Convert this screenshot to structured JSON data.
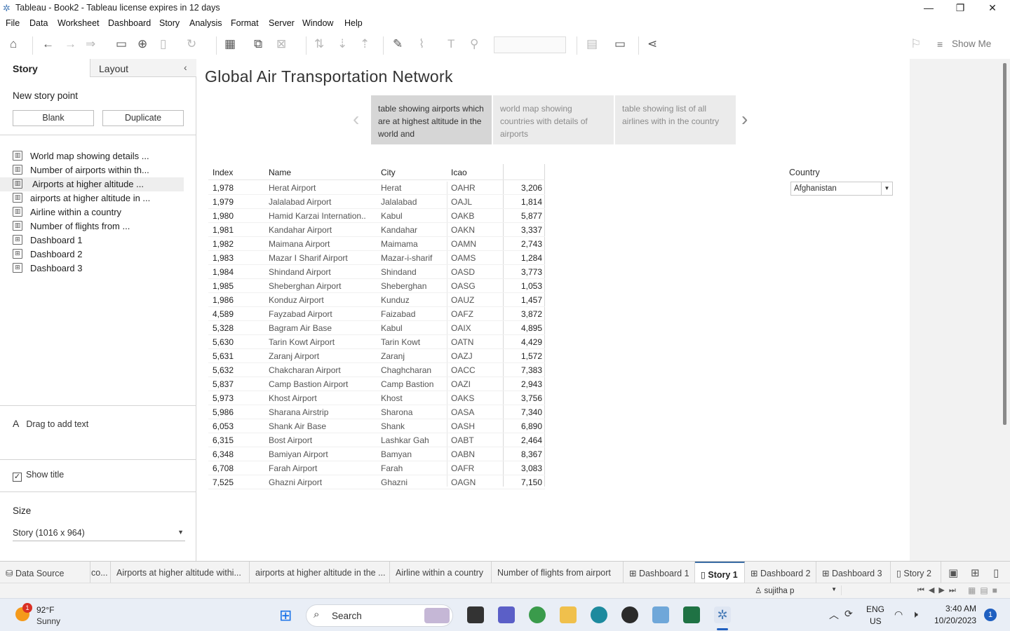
{
  "window": {
    "title": "Tableau - Book2 - Tableau license expires in 12 days"
  },
  "menu": [
    "File",
    "Data",
    "Worksheet",
    "Dashboard",
    "Story",
    "Analysis",
    "Format",
    "Server",
    "Window",
    "Help"
  ],
  "toolbar": {
    "show_me_label": "Show Me"
  },
  "left_panel": {
    "tabs": {
      "story": "Story",
      "layout": "Layout"
    },
    "new_story_point_label": "New story point",
    "blank_button": "Blank",
    "duplicate_button": "Duplicate",
    "sheets": [
      {
        "label": "World map showing  details ...",
        "type": "worksheet"
      },
      {
        "label": "Number of airports within th...",
        "type": "worksheet"
      },
      {
        "label": "Airports at higher altitude ...",
        "type": "worksheet",
        "selected": true
      },
      {
        "label": "airports at higher altitude in ...",
        "type": "worksheet"
      },
      {
        "label": "Airline within a country",
        "type": "worksheet"
      },
      {
        "label": "Number of flights from ...",
        "type": "worksheet"
      },
      {
        "label": "Dashboard 1",
        "type": "dashboard"
      },
      {
        "label": "Dashboard 2",
        "type": "dashboard"
      },
      {
        "label": "Dashboard 3",
        "type": "dashboard"
      }
    ],
    "drag_text_label": "Drag to add text",
    "show_title_label": "Show title",
    "size_label": "Size",
    "size_value": "Story (1016 x 964)"
  },
  "story": {
    "title": "Global Air  Transportation Network",
    "points": [
      {
        "caption": "table showing airports which are at highest altitude in the world and",
        "active": true
      },
      {
        "caption": "world map showing countries with details of airports",
        "active": false
      },
      {
        "caption": "table showing list of all airlines with in the country",
        "active": false
      }
    ]
  },
  "table": {
    "headers": [
      "Index",
      "Name",
      "City",
      "Icao",
      ""
    ],
    "rows": [
      [
        "1,978",
        "Herat Airport",
        "Herat",
        "OAHR",
        "3,206"
      ],
      [
        "1,979",
        "Jalalabad Airport",
        "Jalalabad",
        "OAJL",
        "1,814"
      ],
      [
        "1,980",
        "Hamid Karzai Internation..",
        "Kabul",
        "OAKB",
        "5,877"
      ],
      [
        "1,981",
        "Kandahar Airport",
        "Kandahar",
        "OAKN",
        "3,337"
      ],
      [
        "1,982",
        "Maimana Airport",
        "Maimama",
        "OAMN",
        "2,743"
      ],
      [
        "1,983",
        "Mazar I Sharif Airport",
        "Mazar-i-sharif",
        "OAMS",
        "1,284"
      ],
      [
        "1,984",
        "Shindand Airport",
        "Shindand",
        "OASD",
        "3,773"
      ],
      [
        "1,985",
        "Sheberghan Airport",
        "Sheberghan",
        "OASG",
        "1,053"
      ],
      [
        "1,986",
        "Konduz Airport",
        "Kunduz",
        "OAUZ",
        "1,457"
      ],
      [
        "4,589",
        "Fayzabad Airport",
        "Faizabad",
        "OAFZ",
        "3,872"
      ],
      [
        "5,328",
        "Bagram Air Base",
        "Kabul",
        "OAIX",
        "4,895"
      ],
      [
        "5,630",
        "Tarin Kowt Airport",
        "Tarin Kowt",
        "OATN",
        "4,429"
      ],
      [
        "5,631",
        "Zaranj Airport",
        "Zaranj",
        "OAZJ",
        "1,572"
      ],
      [
        "5,632",
        "Chakcharan Airport",
        "Chaghcharan",
        "OACC",
        "7,383"
      ],
      [
        "5,837",
        "Camp Bastion Airport",
        "Camp Bastion",
        "OAZI",
        "2,943"
      ],
      [
        "5,973",
        "Khost Airport",
        "Khost",
        "OAKS",
        "3,756"
      ],
      [
        "5,986",
        "Sharana Airstrip",
        "Sharona",
        "OASA",
        "7,340"
      ],
      [
        "6,053",
        "Shank Air Base",
        "Shank",
        "OASH",
        "6,890"
      ],
      [
        "6,315",
        "Bost Airport",
        "Lashkar Gah",
        "OABT",
        "2,464"
      ],
      [
        "6,348",
        "Bamiyan Airport",
        "Bamyan",
        "OABN",
        "8,367"
      ],
      [
        "6,708",
        "Farah Airport",
        "Farah",
        "OAFR",
        "3,083"
      ],
      [
        "7,525",
        "Ghazni Airport",
        "Ghazni",
        "OAGN",
        "7,150"
      ]
    ]
  },
  "filter": {
    "label": "Country",
    "value": "Afghanistan"
  },
  "sheet_tabs": [
    {
      "label": "Data Source"
    },
    {
      "label": "co..."
    },
    {
      "label": "Airports at higher altitude withi..."
    },
    {
      "label": "airports at higher altitude in the ..."
    },
    {
      "label": "Airline within a country"
    },
    {
      "label": "Number of flights from airport"
    },
    {
      "label": "Dashboard 1"
    },
    {
      "label": "Story 1",
      "active": true
    },
    {
      "label": "Dashboard 2"
    },
    {
      "label": "Dashboard 3"
    },
    {
      "label": "Story 2"
    }
  ],
  "status": {
    "user": "sujitha p"
  },
  "taskbar": {
    "weather_temp": "92°F",
    "weather_desc": "Sunny",
    "weather_badge": "1",
    "search_label": "Search",
    "lang_line1": "ENG",
    "lang_line2": "US",
    "time": "3:40 AM",
    "date": "10/20/2023",
    "notification_count": "1"
  }
}
